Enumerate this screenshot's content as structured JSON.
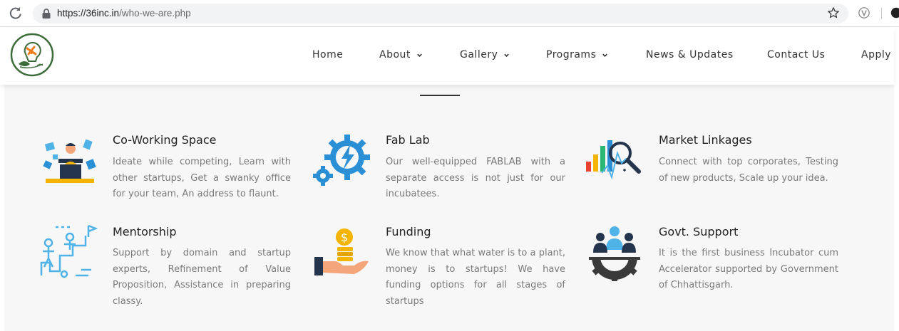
{
  "browser": {
    "url_host": "https://36inc.in",
    "url_path": "/who-we-are.php"
  },
  "nav": {
    "items": [
      {
        "label": "Home"
      },
      {
        "label": "About"
      },
      {
        "label": "Gallery"
      },
      {
        "label": "Programs"
      },
      {
        "label": "News & Updates"
      },
      {
        "label": "Contact Us"
      },
      {
        "label": "Apply"
      }
    ]
  },
  "features": [
    {
      "title": "Co-Working Space",
      "desc": "Ideate while competing, Learn with other startups, Get a swanky office for your team, An address to flaunt.",
      "icon": "coworking-icon"
    },
    {
      "title": "Fab Lab",
      "desc": "Our well-equipped FABLAB with a separate access is not just for our incubatees.",
      "icon": "fablab-icon"
    },
    {
      "title": "Market Linkages",
      "desc": "Connect with top corporates, Testing of new products, Scale up your idea.",
      "icon": "market-icon"
    },
    {
      "title": "Mentorship",
      "desc": "Support by domain and startup experts, Refinement of Value Proposition, Assistance in preparing classy.",
      "icon": "mentorship-icon"
    },
    {
      "title": "Funding",
      "desc": "We know that what water is to a plant, money is to startups! We have funding options for all stages of startups",
      "icon": "funding-icon"
    },
    {
      "title": "Govt. Support",
      "desc": "It is the first business Incubator cum Accelerator supported by Government of Chhattisgarh.",
      "icon": "govt-icon"
    }
  ],
  "colors": {
    "primary_blue": "#2b8fd6",
    "light_blue": "#4fb3e8",
    "navy": "#24344d",
    "gold": "#f5b400",
    "content_bg": "#f7f7f7",
    "logo_green": "#3d6b3a",
    "logo_orange": "#f07c1e"
  }
}
